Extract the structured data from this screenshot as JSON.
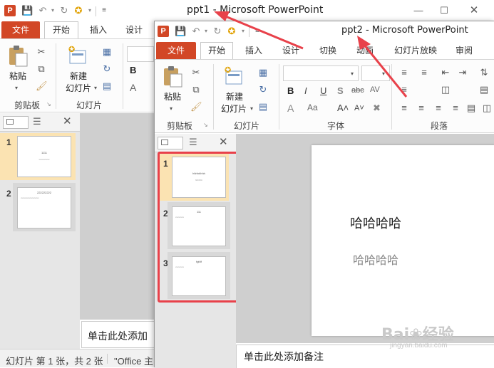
{
  "win1": {
    "title": "ppt1  -  Microsoft PowerPoint",
    "file_tab": "文件",
    "tabs": [
      "开始",
      "插入",
      "设计"
    ],
    "paste_label": "粘贴",
    "new_slide_label_1": "新建",
    "new_slide_label_2": "幻灯片",
    "group_clipboard": "剪贴板",
    "group_slides": "幻灯片",
    "slides": [
      {
        "num": "1",
        "title": "1111",
        "sub": "xxxxxxxxxx"
      },
      {
        "num": "2",
        "title": "222222222",
        "sub": "xxxxxxxxxxxxxxxxx"
      }
    ],
    "notes_placeholder": "单击此处添加",
    "status_slide": "幻灯片 第 1 张，共 2 张",
    "status_theme": "\"Office 主"
  },
  "win2": {
    "title": "ppt2  -  Microsoft PowerPoint",
    "file_tab": "文件",
    "tabs": [
      "开始",
      "插入",
      "设计",
      "切换",
      "动画",
      "幻灯片放映",
      "审阅"
    ],
    "paste_label": "粘贴",
    "new_slide_label_1": "新建",
    "new_slide_label_2": "幻灯片",
    "group_clipboard": "剪贴板",
    "group_slides": "幻灯片",
    "group_font": "字体",
    "group_paragraph": "段落",
    "slides": [
      {
        "num": "1",
        "title": "hhhhhhhh",
        "sub": "hhhhhh"
      },
      {
        "num": "2",
        "title": "111",
        "sub": "xxxxxxxx"
      },
      {
        "num": "3",
        "title": "fgfdf",
        "sub": "xxxxxxxx"
      }
    ],
    "main_slide_title": "哈哈哈哈",
    "main_slide_subtitle": "哈哈哈哈",
    "notes_placeholder": "单击此处添加备注"
  },
  "watermark": {
    "brand": "Bai",
    "brand2": "经验",
    "url": "jingyan.baidu.com"
  },
  "colors": {
    "file_tab": "#d24726",
    "highlight": "#e8414a",
    "thumb_selected": "#fbe3b2"
  }
}
